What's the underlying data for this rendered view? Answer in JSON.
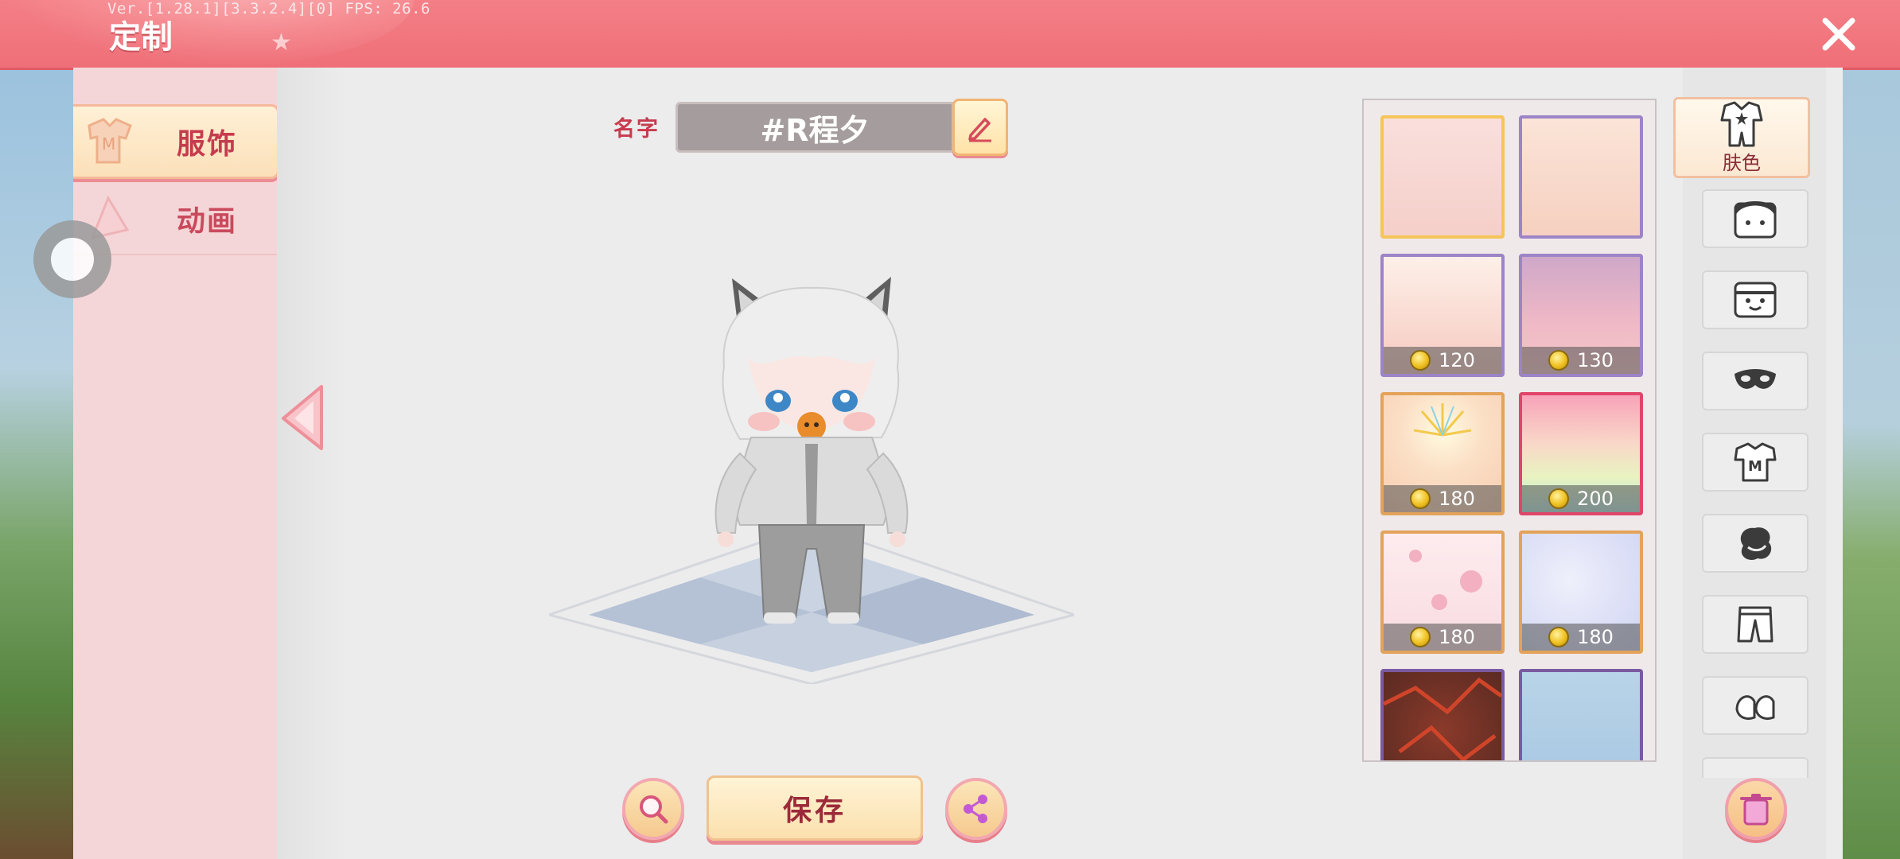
{
  "debug_text": "Ver.[1.28.1][3.3.2.4][0] FPS: 26.6",
  "title": "定制",
  "left_tabs": [
    {
      "label": "服饰",
      "active": true
    },
    {
      "label": "动画",
      "active": false
    }
  ],
  "name_field": {
    "label": "名字",
    "value": "#R程夕"
  },
  "save_label": "保存",
  "skin_swatches": [
    {
      "price": "",
      "selected": true
    },
    {
      "price": ""
    },
    {
      "price": "120"
    },
    {
      "price": "130"
    },
    {
      "price": "180"
    },
    {
      "price": "200"
    },
    {
      "price": "180"
    },
    {
      "price": "180"
    },
    {
      "price": ""
    },
    {
      "price": ""
    }
  ],
  "categories": [
    {
      "icon": "onesie-icon",
      "label": "肤色",
      "active": true
    },
    {
      "icon": "face-icon"
    },
    {
      "icon": "expression-icon"
    },
    {
      "icon": "mask-icon"
    },
    {
      "icon": "shirt-icon"
    },
    {
      "icon": "glove-icon"
    },
    {
      "icon": "pants-icon"
    },
    {
      "icon": "shoes-icon"
    }
  ],
  "colors": {
    "accent": "#ef6f78",
    "label_red": "#c73b4e"
  }
}
